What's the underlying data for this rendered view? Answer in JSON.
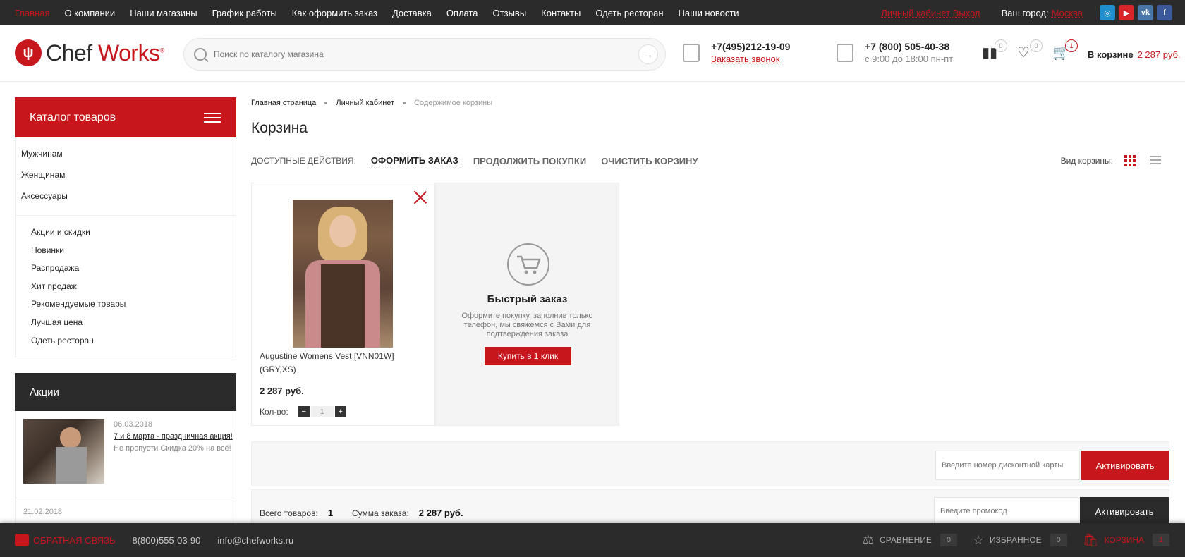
{
  "topnav": {
    "items": [
      {
        "label": "Главная",
        "active": true
      },
      {
        "label": "О компании"
      },
      {
        "label": "Наши магазины"
      },
      {
        "label": "График работы"
      },
      {
        "label": "Как оформить заказ"
      },
      {
        "label": "Доставка"
      },
      {
        "label": "Оплата"
      },
      {
        "label": "Отзывы"
      },
      {
        "label": "Контакты"
      },
      {
        "label": "Одеть ресторан"
      },
      {
        "label": "Наши новости"
      }
    ],
    "cabinet": "Личный кабинет",
    "logout": "Выход",
    "city_label": "Ваш город:",
    "city": "Москва",
    "social": [
      {
        "icon": "instagram-icon",
        "glyph": "◎",
        "color": "#1f8fcf"
      },
      {
        "icon": "youtube-icon",
        "glyph": "▶",
        "color": "#d9252a"
      },
      {
        "icon": "vk-icon",
        "glyph": "vk",
        "color": "#4a76a8"
      },
      {
        "icon": "facebook-icon",
        "glyph": "f",
        "color": "#3b5998"
      }
    ]
  },
  "header": {
    "logo_chef": "Chef",
    "logo_works": "Works",
    "logo_mark": "®",
    "search_placeholder": "Поиск по каталогу магазина",
    "phone1": "+7(495)212-19-09",
    "callback": "Заказать звонок",
    "phone2": "+7 (800) 505-40-38",
    "hours": "с 9:00 до 18:00 пн-пт",
    "compare_count": "0",
    "favorites_count": "0",
    "cart_count": "1",
    "cart_label": "В корзине",
    "cart_sum": "2 287 руб."
  },
  "sidebar": {
    "catalog_title": "Каталог товаров",
    "main_items": [
      "Мужчинам",
      "Женщинам",
      "Аксессуары"
    ],
    "sub_items": [
      "Акции и скидки",
      "Новинки",
      "Распродажа",
      "Хит продаж",
      "Рекомендуемые товары",
      "Лучшая цена",
      "Одеть ресторан"
    ],
    "promo_title": "Акции",
    "promo": {
      "date": "06.03.2018",
      "link": "7 и 8 марта - праздничная акция!",
      "text": "Не пропусти Скидка 20% на всё!",
      "date2": "21.02.2018"
    }
  },
  "main": {
    "breadcrumbs": [
      "Главная страница",
      "Личный кабинет",
      "Содержимое корзины"
    ],
    "title": "Корзина",
    "actions_label": "ДОСТУПНЫЕ ДЕЙСТВИЯ:",
    "action_checkout": "ОФОРМИТЬ ЗАКАЗ",
    "action_continue": "ПРОДОЛЖИТЬ ПОКУПКИ",
    "action_clear": "ОЧИСТИТЬ КОРЗИНУ",
    "view_label": "Вид корзины:",
    "product": {
      "name": "Augustine Womens Vest [VNN01W] (GRY,XS)",
      "price": "2 287 руб.",
      "qty_label": "Кол-во:",
      "qty": "1"
    },
    "quick_order": {
      "title": "Быстрый заказ",
      "desc": "Оформите покупку, заполнив только телефон, мы свяжемся с Вами для подтверждения заказа",
      "button": "Купить в 1 клик"
    },
    "discount_placeholder": "Введите номер дисконтной карты",
    "discount_button": "Активировать",
    "total_items_label": "Всего товаров:",
    "total_items": "1",
    "total_sum_label": "Сумма заказа:",
    "total_sum": "2 287 руб.",
    "promo_placeholder": "Введите промокод",
    "promo_button": "Активировать"
  },
  "footer": {
    "feedback": "ОБРАТНАЯ СВЯЗЬ",
    "phone": "8(800)555-03-90",
    "email": "info@chefworks.ru",
    "compare": "СРАВНЕНИЕ",
    "compare_count": "0",
    "favorites": "ИЗБРАННОЕ",
    "favorites_count": "0",
    "cart": "КОРЗИНА",
    "cart_count": "1"
  }
}
